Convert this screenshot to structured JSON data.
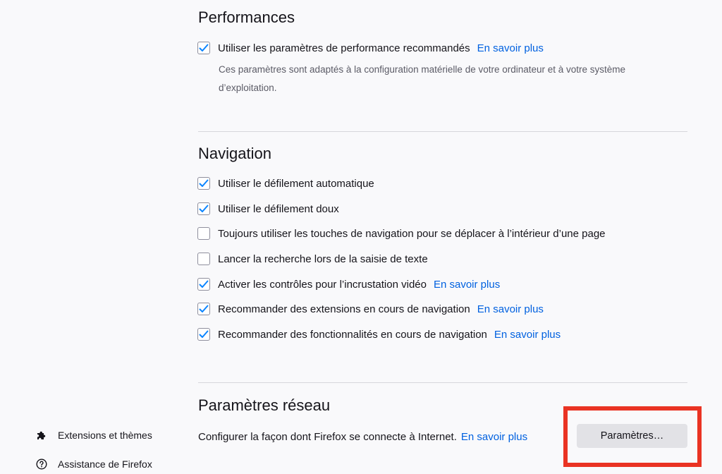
{
  "performance": {
    "title": "Performances",
    "recommended": {
      "label": "Utiliser les paramètres de performance recommandés",
      "checked": true,
      "learn_more": "En savoir plus"
    },
    "description": "Ces paramètres sont adaptés à la configuration matérielle de votre ordinateur et à votre système d’exploitation."
  },
  "navigation": {
    "title": "Navigation",
    "options": [
      {
        "label": "Utiliser le défilement automatique",
        "checked": true
      },
      {
        "label": "Utiliser le défilement doux",
        "checked": true
      },
      {
        "label": "Toujours utiliser les touches de navigation pour se déplacer à l’intérieur d’une page",
        "checked": false
      },
      {
        "label": "Lancer la recherche lors de la saisie de texte",
        "checked": false
      },
      {
        "label": "Activer les contrôles pour l’incrustation vidéo",
        "checked": true,
        "learn_more": "En savoir plus"
      },
      {
        "label": "Recommander des extensions en cours de navigation",
        "checked": true,
        "learn_more": "En savoir plus"
      },
      {
        "label": "Recommander des fonctionnalités en cours de navigation",
        "checked": true,
        "learn_more": "En savoir plus"
      }
    ]
  },
  "network": {
    "title": "Paramètres réseau",
    "description": "Configurer la façon dont Firefox se connecte à Internet.",
    "learn_more": "En savoir plus",
    "button_label": "Paramètres…"
  },
  "sidebar": {
    "items": [
      {
        "label": "Extensions et thèmes",
        "icon": "puzzle-icon"
      },
      {
        "label": "Assistance de Firefox",
        "icon": "help-circle-icon"
      }
    ]
  },
  "colors": {
    "accent": "#0061e0",
    "checkmark": "#0a84ff",
    "highlight": "#ea3323",
    "background": "#f9f9fb"
  }
}
